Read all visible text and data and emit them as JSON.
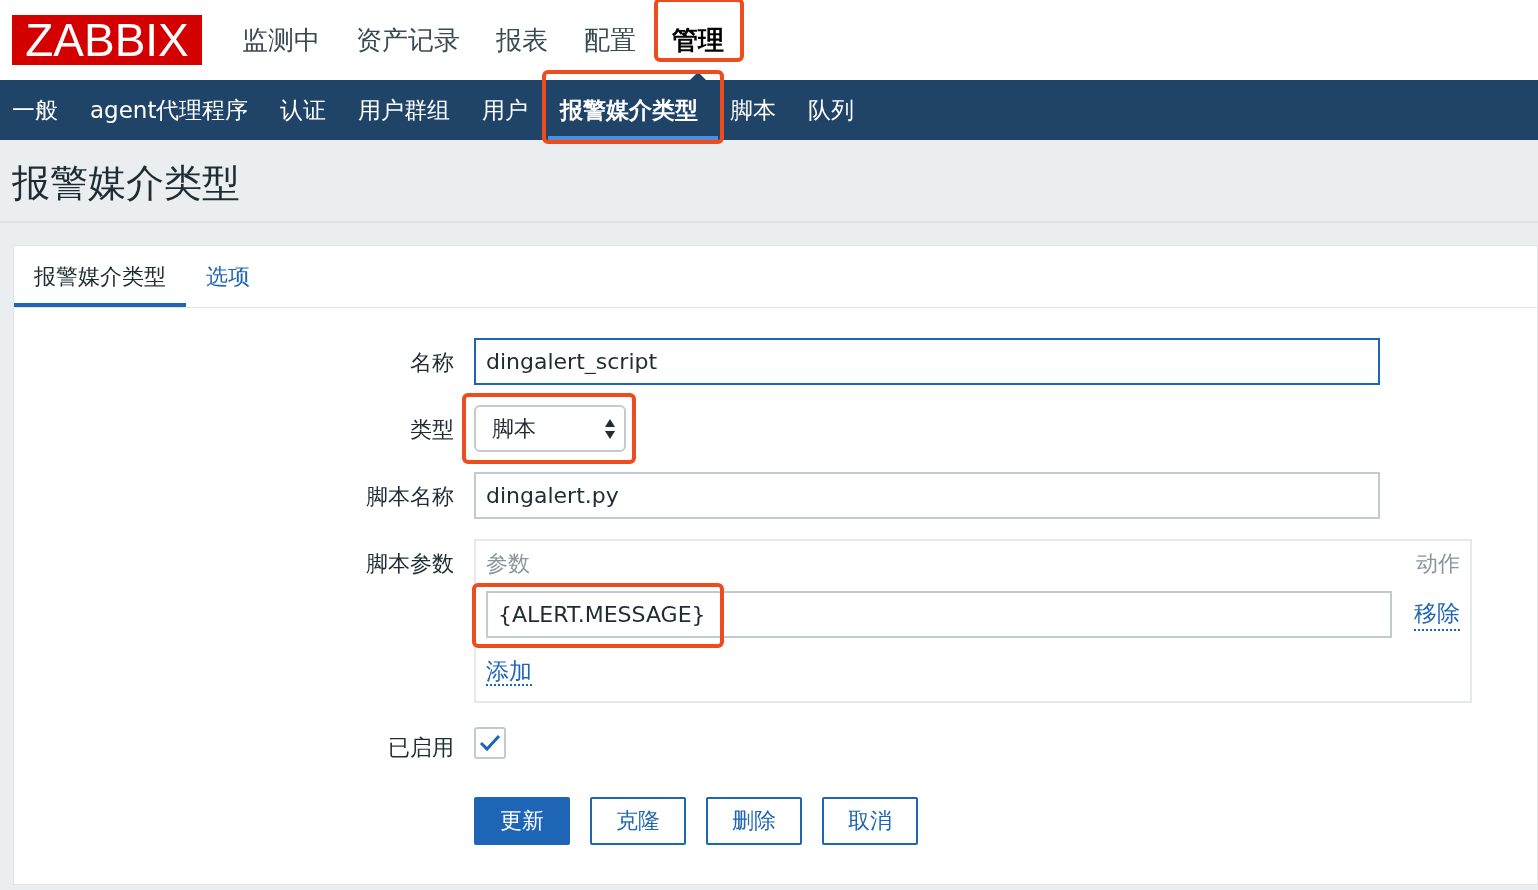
{
  "logo": "ZABBIX",
  "top_menu": [
    {
      "label": "监测中",
      "selected": false,
      "highlighted": false
    },
    {
      "label": "资产记录",
      "selected": false,
      "highlighted": false
    },
    {
      "label": "报表",
      "selected": false,
      "highlighted": false
    },
    {
      "label": "配置",
      "selected": false,
      "highlighted": false
    },
    {
      "label": "管理",
      "selected": true,
      "highlighted": true
    }
  ],
  "sub_menu": [
    {
      "label": "一般",
      "selected": false,
      "highlighted": false
    },
    {
      "label": "agent代理程序",
      "selected": false,
      "highlighted": false
    },
    {
      "label": "认证",
      "selected": false,
      "highlighted": false
    },
    {
      "label": "用户群组",
      "selected": false,
      "highlighted": false
    },
    {
      "label": "用户",
      "selected": false,
      "highlighted": false
    },
    {
      "label": "报警媒介类型",
      "selected": true,
      "highlighted": true
    },
    {
      "label": "脚本",
      "selected": false,
      "highlighted": false
    },
    {
      "label": "队列",
      "selected": false,
      "highlighted": false
    }
  ],
  "page_title": "报警媒介类型",
  "tabs": [
    {
      "label": "报警媒介类型",
      "selected": true
    },
    {
      "label": "选项",
      "selected": false
    }
  ],
  "form": {
    "name": {
      "label": "名称",
      "value": "dingalert_script",
      "focused": true
    },
    "type": {
      "label": "类型",
      "value": "脚本",
      "highlighted": true
    },
    "script_name": {
      "label": "脚本名称",
      "value": "dingalert.py"
    },
    "script_params": {
      "label": "脚本参数",
      "columns": [
        "参数",
        "动作"
      ],
      "rows": [
        {
          "value": "{ALERT.MESSAGE}",
          "action": "移除",
          "highlighted": true
        }
      ],
      "add": "添加"
    },
    "enabled": {
      "label": "已启用",
      "checked": true
    }
  },
  "buttons": [
    {
      "label": "更新",
      "primary": true
    },
    {
      "label": "克隆",
      "primary": false
    },
    {
      "label": "删除",
      "primary": false
    },
    {
      "label": "取消",
      "primary": false
    }
  ]
}
